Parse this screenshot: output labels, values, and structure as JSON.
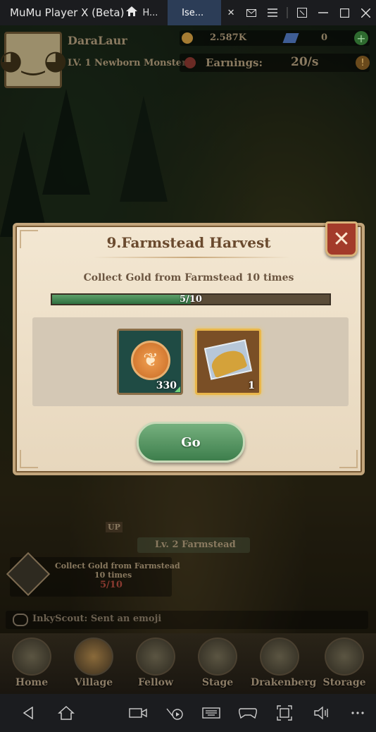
{
  "titlebar": {
    "app_title": "MuMu Player X  (Beta)",
    "tabs": [
      {
        "label": "H..."
      },
      {
        "label": "Ise..."
      }
    ]
  },
  "hud": {
    "player_name": "DaraLaur",
    "player_level": "LV. 1 Newborn Monster",
    "gold": "2.587K",
    "gems": "0",
    "earnings_label": "Earnings:",
    "earnings_value": "20/s"
  },
  "dialog": {
    "title": "9.Farmstead Harvest",
    "description": "Collect Gold from Farmstead 10 times",
    "progress": {
      "current": 5,
      "total": 10,
      "text": "5/10"
    },
    "rewards": [
      {
        "name": "gold",
        "count": "330"
      },
      {
        "name": "harvest-map",
        "count": "1"
      }
    ],
    "go_label": "Go"
  },
  "scene": {
    "farm_label": "Lv. 2 Farmstead",
    "sign_text": "UP",
    "quest_mini": {
      "line1": "Collect Gold from Farmstead",
      "line2": "10 times",
      "progress": "5/10"
    },
    "chat_text": "InkyScout: Sent an emoji"
  },
  "nav": {
    "items": [
      {
        "label": "Home"
      },
      {
        "label": "Village"
      },
      {
        "label": "Fellow"
      },
      {
        "label": "Stage"
      },
      {
        "label": "Drakenberg"
      },
      {
        "label": "Storage"
      }
    ]
  },
  "colors": {
    "titlebar_bg": "#1b1c1f",
    "active_tab": "#2c3d57",
    "dialog_bg": "#f3e7d2",
    "progress_fill": "#3f8a52",
    "close_button": "#a33b2a",
    "go_button": "#5a9a66"
  }
}
